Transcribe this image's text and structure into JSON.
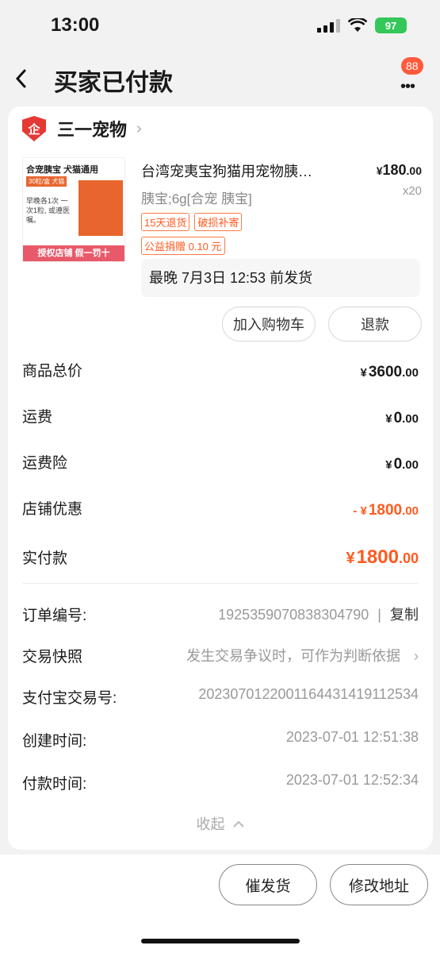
{
  "status_bar": {
    "time": "13:00",
    "battery": "97"
  },
  "nav": {
    "title": "买家已付款",
    "message_badge": "88"
  },
  "shop": {
    "logo_text": "企",
    "name": "三一宠物"
  },
  "product": {
    "image": {
      "title": "合宠胰宝 犬猫通用",
      "tag": "30粒/盒 犬猫",
      "note": "早晚各1次 一次1粒, 或遵医嘱。",
      "banner": "授权店铺 假一罚十"
    },
    "title": "台湾宠夷宝狗猫用宠物胰…",
    "price_yen": "¥",
    "price_int": "180",
    "price_dec": ".00",
    "sku": "胰宝;6g[合宠 胰宝]",
    "quantity": "x20",
    "tags": [
      "15天退货",
      "破损补寄"
    ],
    "charity_tag": "公益捐赠 0.10 元",
    "ship_deadline": "最晚 7月3日 12:53 前发货",
    "add_cart_label": "加入购物车",
    "refund_label": "退款"
  },
  "costs": [
    {
      "label": "商品总价",
      "yen": "¥",
      "int": "3600",
      "dec": ".00"
    },
    {
      "label": "运费",
      "yen": "¥",
      "int": "0",
      "dec": ".00"
    },
    {
      "label": "运费险",
      "yen": "¥",
      "int": "0",
      "dec": ".00"
    },
    {
      "label": "店铺优惠",
      "yen": "- ¥",
      "int": "1800",
      "dec": ".00"
    },
    {
      "label": "实付款",
      "yen": "¥",
      "int": "1800",
      "dec": ".00"
    }
  ],
  "info": {
    "order_no_label": "订单编号:",
    "order_no": "1925359070838304790",
    "copy_label": "复制",
    "snapshot_label": "交易快照",
    "snapshot_value": "发生交易争议时，可作为判断依据",
    "alipay_label": "支付宝交易号:",
    "alipay_value": "20230701220011644314191125​34",
    "created_label": "创建时间:",
    "created_value": "2023-07-01 12:51:38",
    "paid_label": "付款时间:",
    "paid_value": "2023-07-01 12:52:34",
    "collapse_label": "收起"
  },
  "bottom": {
    "urge_label": "催发货",
    "modify_label": "修改地址"
  }
}
